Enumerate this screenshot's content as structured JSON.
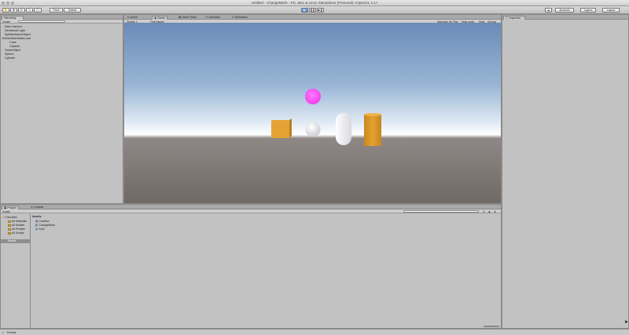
{
  "window": {
    "title": "Untitled - ChangeMesh - PC, Mac & Linux Standalone (Personal) <OpenGL 4.1>"
  },
  "toolbar": {
    "pivot": "Pivot",
    "global": "Global",
    "collab": "Collab",
    "account": "Account",
    "layers": "Layers",
    "layout": "Layout"
  },
  "hierarchy": {
    "tab": "Hierarchy",
    "create": "Create",
    "items": [
      "Main Camera",
      "Directional Light",
      "MyMainGameObject",
      "OtherMeshMainLocal",
      "Cube",
      "Capsule",
      "GameObject",
      "Sphere",
      "Cylinder"
    ]
  },
  "center_tabs": {
    "scene": "Scene",
    "game": "Game",
    "asset_store": "Asset Store",
    "animator": "Animator",
    "animation": "Animation"
  },
  "game_view": {
    "display": "Display 1",
    "aspect": "Free Aspect",
    "maximize": "Maximize On Play",
    "mute": "Mute audio",
    "stats": "Stats",
    "gizmos": "Gizmos"
  },
  "inspector": {
    "tab": "Inspector"
  },
  "project": {
    "tab": "Project",
    "console_tab": "Console",
    "create": "Create",
    "favorites": "Favorites",
    "fav_items": [
      "All Materials",
      "All Models",
      "All Prefabs",
      "All Scripts"
    ],
    "assets_root": "Assets",
    "breadcrumb": "Assets",
    "asset_items": [
      "Cardbox",
      "ChangeMesh",
      "Gold"
    ]
  },
  "status": {
    "text": "Preload"
  },
  "colors": {
    "sphere": "#f33ef0",
    "cube": "#e5a335",
    "cylinder": "#e5a130",
    "capsule": "#f4f4f6"
  }
}
